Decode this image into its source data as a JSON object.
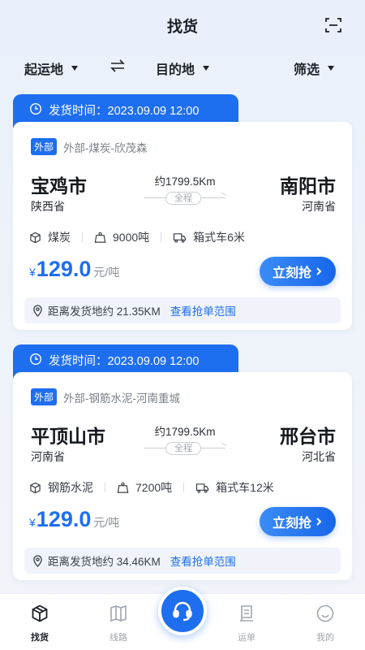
{
  "header": {
    "title": "找货"
  },
  "filters": {
    "origin": "起运地",
    "destination": "目的地",
    "filter": "筛选"
  },
  "orders": [
    {
      "ship_time": "发货时间：2023.09.09 12:00",
      "badge": "外部",
      "source": "外部-煤炭-欣茂森",
      "from_city": "宝鸡市",
      "from_province": "陕西省",
      "to_city": "南阳市",
      "to_province": "河南省",
      "distance": "约1799.5Km",
      "route_label": "全程",
      "cargo": "煤炭",
      "weight": "9000吨",
      "vehicle": "箱式车6米",
      "currency": "¥",
      "price": "129.0",
      "price_unit": "元/吨",
      "grab_label": "立刻抢",
      "distance_text": "距离发货地约 21.35KM",
      "range_link": "查看抢单范围"
    },
    {
      "ship_time": "发货时间：2023.09.09 12:00",
      "badge": "外部",
      "source": "外部-钢筋水泥-河南重城",
      "from_city": "平顶山市",
      "from_province": "河南省",
      "to_city": "邢台市",
      "to_province": "河北省",
      "distance": "约1799.5Km",
      "route_label": "全程",
      "cargo": "钢筋水泥",
      "weight": "7200吨",
      "vehicle": "箱式车12米",
      "currency": "¥",
      "price": "129.0",
      "price_unit": "元/吨",
      "grab_label": "立刻抢",
      "distance_text": "距离发货地约 34.46KM",
      "range_link": "查看抢单范围"
    }
  ],
  "tabbar": {
    "items": [
      "找货",
      "线路",
      "运单",
      "我的"
    ],
    "active": "找货"
  },
  "colors": {
    "accent": "#1e6ef0",
    "text": "#1f2329",
    "muted": "#a0a6af"
  },
  "icons": [
    "scan-icon",
    "swap-icon",
    "clock-icon",
    "box-icon",
    "scale-icon",
    "truck-icon",
    "location-icon",
    "headset-icon",
    "cube-icon",
    "map-icon",
    "receipt-icon",
    "smile-icon"
  ]
}
